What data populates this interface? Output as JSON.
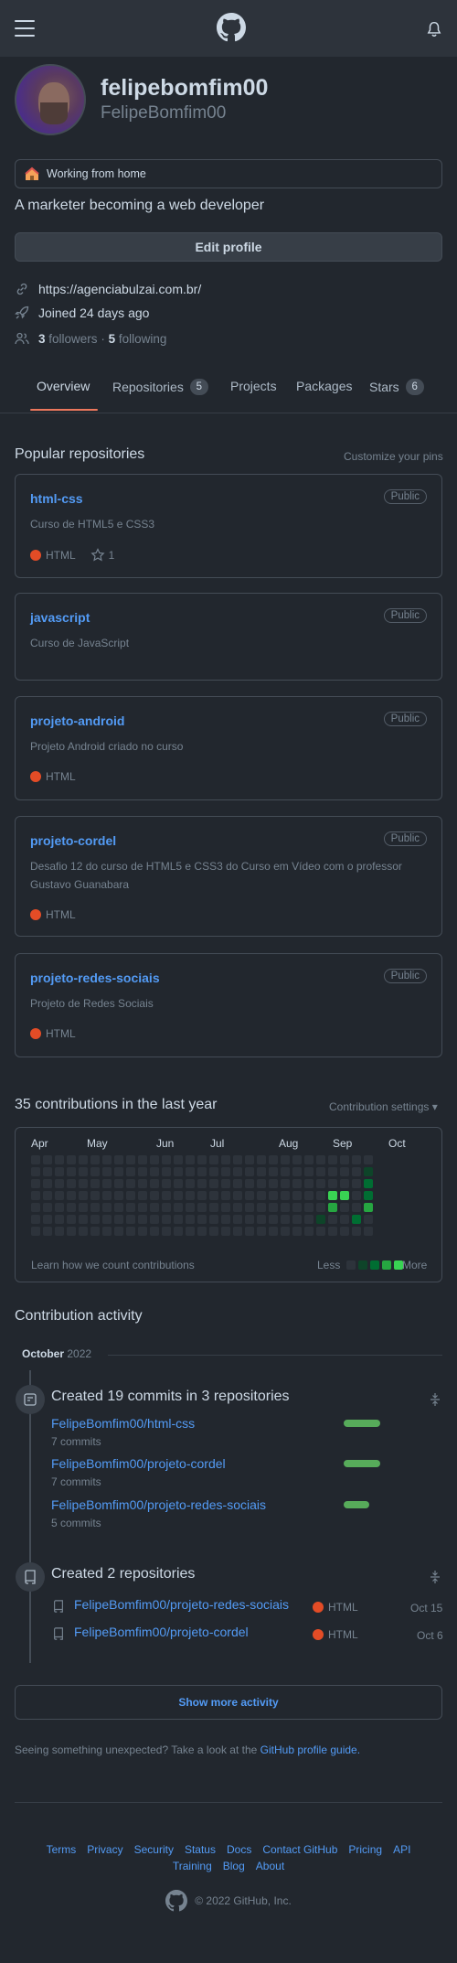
{
  "profile": {
    "name": "felipebomfim00",
    "login": "FelipeBomfim00",
    "status": "Working from home",
    "bio": "A marketer becoming a web developer",
    "edit_label": "Edit profile",
    "website": "https://agenciabulzai.com.br/",
    "joined": "Joined 24 days ago",
    "followers_count": "3",
    "followers_label": "followers",
    "separator": "·",
    "following_count": "5",
    "following_label": "following"
  },
  "tabs": [
    {
      "label": "Overview"
    },
    {
      "label": "Repositories",
      "count": "5"
    },
    {
      "label": "Projects"
    },
    {
      "label": "Packages"
    },
    {
      "label": "Stars",
      "count": "6"
    }
  ],
  "popular": {
    "title": "Popular repositories",
    "customize": "Customize your pins",
    "repos": [
      {
        "name": "html-css",
        "visibility": "Public",
        "description": "Curso de HTML5 e CSS3",
        "language": "HTML",
        "stars": "1"
      },
      {
        "name": "javascript",
        "visibility": "Public",
        "description": "Curso de JavaScript"
      },
      {
        "name": "projeto-android",
        "visibility": "Public",
        "description": "Projeto Android criado no curso",
        "language": "HTML"
      },
      {
        "name": "projeto-cordel",
        "visibility": "Public",
        "description": "Desafio 12 do curso de HTML5 e CSS3 do Curso em Vídeo com o professor Gustavo Guanabara",
        "language": "HTML"
      },
      {
        "name": "projeto-redes-sociais",
        "visibility": "Public",
        "description": "Projeto de Redes Sociais",
        "language": "HTML"
      }
    ]
  },
  "contributions": {
    "title": "35 contributions in the last year",
    "settings": "Contribution settings ▾",
    "months": [
      "Apr",
      "May",
      "Jun",
      "Jul",
      "Aug",
      "Sep",
      "Oct"
    ],
    "learn": "Learn how we count contributions",
    "less": "Less",
    "more": "More",
    "colors": [
      "#2d333b",
      "#0e4429",
      "#006d32",
      "#26a641",
      "#39d353"
    ]
  },
  "activity": {
    "title": "Contribution activity",
    "month": "October",
    "year": "2022",
    "commits": {
      "title": "Created 19 commits in 3 repositories",
      "items": [
        {
          "repo": "FelipeBomfim00/html-css",
          "count": "7 commits",
          "share": 0.37
        },
        {
          "repo": "FelipeBomfim00/projeto-cordel",
          "count": "7 commits",
          "share": 0.37
        },
        {
          "repo": "FelipeBomfim00/projeto-redes-sociais",
          "count": "5 commits",
          "share": 0.26
        }
      ]
    },
    "repos": {
      "title": "Created 2 repositories",
      "items": [
        {
          "repo": "FelipeBomfim00/projeto-redes-sociais",
          "language": "HTML",
          "date": "Oct 15"
        },
        {
          "repo": "FelipeBomfim00/projeto-cordel",
          "language": "HTML",
          "date": "Oct 6"
        }
      ]
    },
    "show_more": "Show more activity"
  },
  "unexpected": {
    "text": "Seeing something unexpected? Take a look at the",
    "link": "GitHub profile guide."
  },
  "footer": {
    "row1": [
      "Terms",
      "Privacy",
      "Security",
      "Status",
      "Docs",
      "Contact GitHub",
      "Pricing",
      "API"
    ],
    "row2": [
      "Training",
      "Blog",
      "About"
    ],
    "copyright": "© 2022 GitHub, Inc."
  }
}
